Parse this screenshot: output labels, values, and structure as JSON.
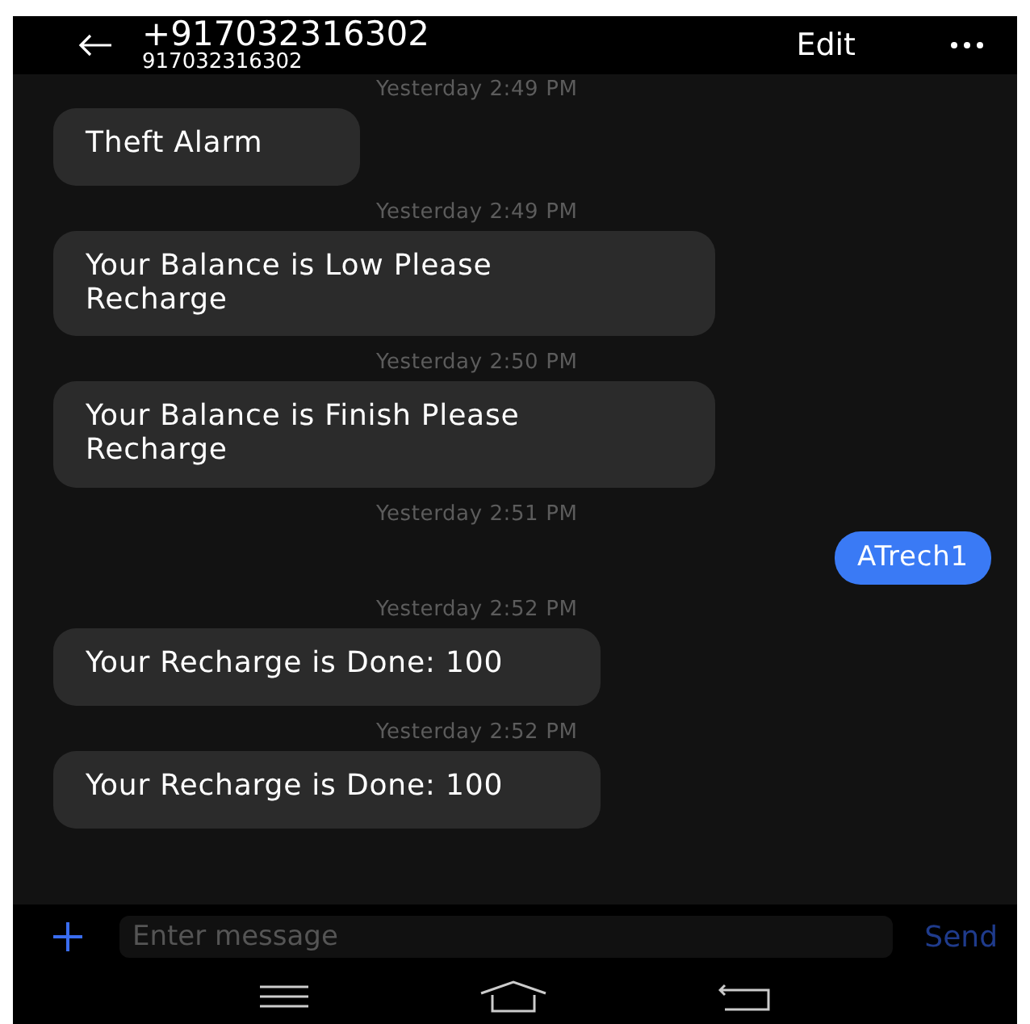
{
  "header": {
    "title": "+917032316302",
    "subtitle": "917032316302",
    "edit": "Edit"
  },
  "messages": [
    {
      "time": "Yesterday 2:49 PM",
      "text": "Theft Alarm",
      "kind": "incoming"
    },
    {
      "time": "Yesterday 2:49 PM",
      "text": "Your Balance is Low Please Recharge",
      "kind": "incoming"
    },
    {
      "time": "Yesterday 2:50 PM",
      "text": "Your Balance is Finish Please Recharge",
      "kind": "incoming"
    },
    {
      "time": "Yesterday 2:51 PM",
      "text": "ATrech1",
      "kind": "outgoing"
    },
    {
      "time": "Yesterday 2:52 PM",
      "text": "Your Recharge is Done: 100",
      "kind": "incoming"
    },
    {
      "time": "Yesterday 2:52 PM",
      "text": "Your Recharge is Done: 100",
      "kind": "incoming"
    }
  ],
  "composer": {
    "placeholder": "Enter message",
    "send": "Send"
  }
}
